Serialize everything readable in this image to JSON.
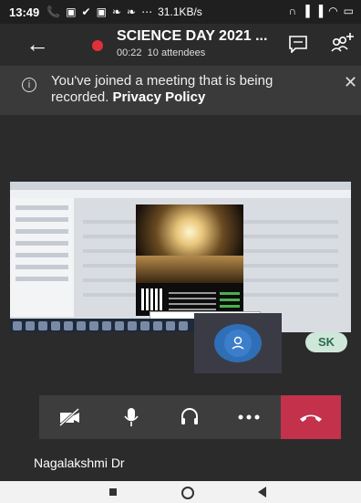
{
  "status_bar": {
    "time": "13:49",
    "net_speed": "31.1KB/s",
    "icons": [
      "phone-icon",
      "message-icon",
      "check-icon",
      "message-icon",
      "leaf-icon",
      "leaf-icon",
      "more-dots",
      "headset-icon",
      "signal-icon",
      "signal-icon",
      "wifi-icon",
      "battery-icon"
    ]
  },
  "header": {
    "title": "SCIENCE DAY 2021 ...",
    "duration": "00:22",
    "attendees": "10 attendees"
  },
  "banner": {
    "message": "You've joined a meeting that is being recorded.",
    "link": "Privacy Policy"
  },
  "participants": {
    "remote_initials": "SK",
    "name_label": "Nagalakshmi Dr"
  },
  "colors": {
    "background": "#2b2b2b",
    "banner": "#3a3a3a",
    "record_dot": "#e0303a",
    "hangup": "#c4314b",
    "self_avatar": "#2f6fb7",
    "sk_avatar_bg": "#cfe7d9",
    "sk_avatar_text": "#2e6b48"
  },
  "controls": {
    "icons": [
      "video-off-icon",
      "microphone-icon",
      "headset-icon",
      "more-icon",
      "hang-up-icon"
    ]
  }
}
